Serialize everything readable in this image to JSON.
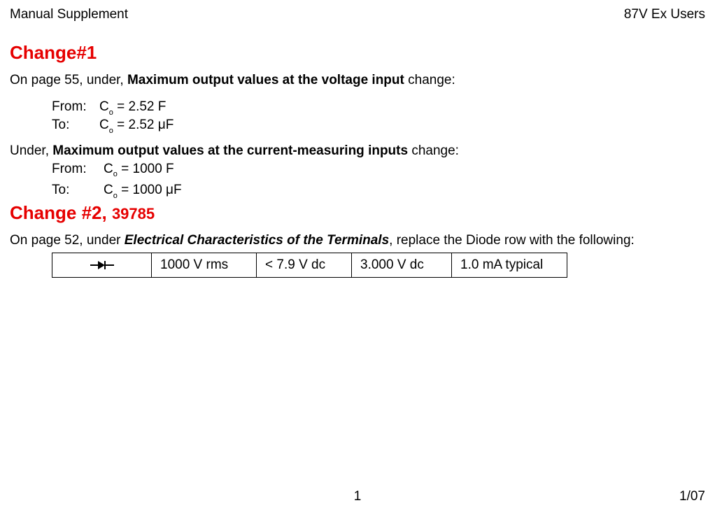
{
  "header": {
    "left": "Manual Supplement",
    "right": "87V Ex Users"
  },
  "change1": {
    "title": "Change#1",
    "intro_prefix": "On page 55, under, ",
    "intro_bold": "Maximum output values at the voltage input",
    "intro_suffix": " change:",
    "from_label": "From:",
    "from_value_pre": "C",
    "from_value_sub": "o",
    "from_value_post": " = 2.52 F",
    "to_label": "To:",
    "to_value_pre": "C",
    "to_value_sub": "o",
    "to_value_post": " = 2.52 μF",
    "second_prefix": "Under, ",
    "second_bold": "Maximum output values at the current-measuring inputs",
    "second_suffix": " change:",
    "from2_value_post": " = 1000 F",
    "to2_value_post": " = 1000 μF"
  },
  "change2": {
    "title_main": "Change #2, ",
    "title_sub": "39785",
    "intro_prefix": "On page 52, under ",
    "intro_bold": "Electrical Characteristics of the Terminals",
    "intro_suffix": ", replace the Diode row with the following:",
    "row": {
      "c1": "1000 V rms",
      "c2": "< 7.9 V dc",
      "c3": "3.000 V dc",
      "c4": "1.0 mA typical"
    }
  },
  "footer": {
    "page": "1",
    "date": "1/07"
  }
}
